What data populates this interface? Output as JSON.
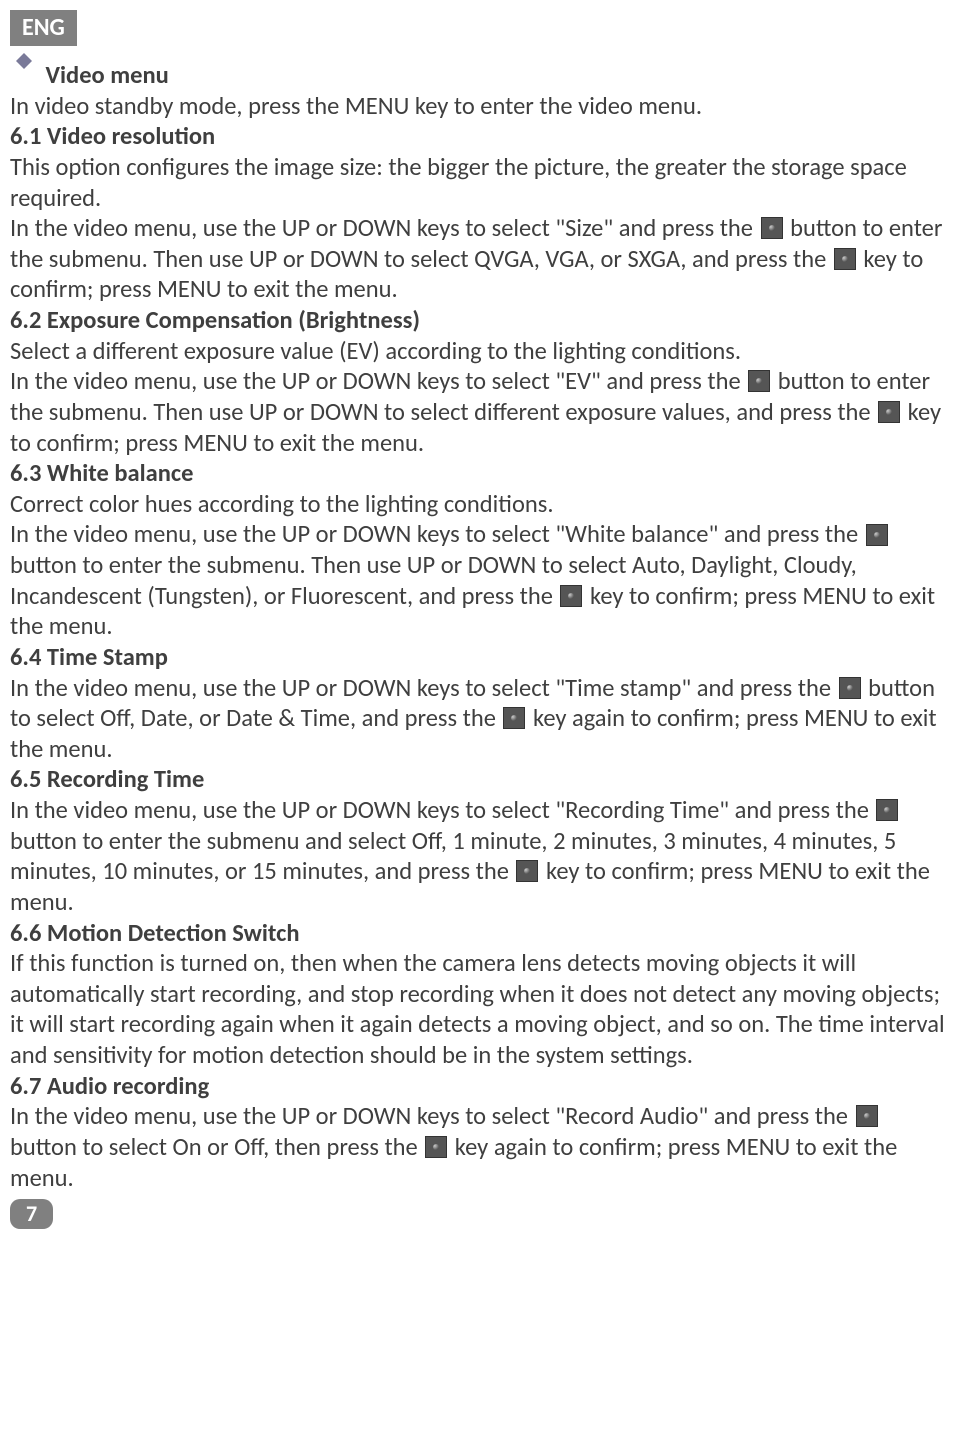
{
  "lang_tab": "ENG",
  "main_title": "Video menu",
  "intro": "In video standby mode, press the MENU key to enter the video menu.",
  "s61_title": "6.1 Video resolution",
  "s61_p1": "This option configures the image size: the bigger the picture, the greater the storage space required.",
  "s61_p2a": "In the video menu, use the UP or DOWN keys to select \"Size\" and press the ",
  "s61_p2b": " button to enter the submenu. Then use UP or DOWN to select QVGA, VGA, or SXGA, and press the ",
  "s61_p2c": " key to confirm; press MENU to exit the menu.",
  "s62_title": "6.2 Exposure Compensation (Brightness)",
  "s62_p1": "Select a different exposure value (EV) according to the lighting conditions.",
  "s62_p2a": "In the video menu, use the UP or DOWN keys to select \"EV\" and press the ",
  "s62_p2b": " button to enter the submenu. Then use UP or DOWN to select different exposure values, and press the ",
  "s62_p2c": " key to confirm; press MENU to exit the menu.",
  "s63_title": "6.3 White balance",
  "s63_p1": "Correct color hues according to the lighting conditions.",
  "s63_p2a": "In the video menu, use the UP or DOWN keys to select \"White balance\" and press the ",
  "s63_p2b": " button to enter the submenu. Then use UP or DOWN to select Auto, Daylight, Cloudy, Incandescent (Tungsten), or Fluorescent, and press the ",
  "s63_p2c": " key to confirm; press MENU to exit the menu.",
  "s64_title": "6.4 Time Stamp",
  "s64_p1a": "In the video menu, use the UP or DOWN keys to select \"Time stamp\" and press the ",
  "s64_p1b": " button to select Off, Date, or Date & Time, and press the ",
  "s64_p1c": " key again to confirm; press MENU to exit the menu.",
  "s65_title": "6.5 Recording Time",
  "s65_p1a": "In the video menu, use the UP or DOWN keys to select \"Recording Time\" and press the ",
  "s65_p1b": " button to enter the submenu and select Off, 1 minute, 2 minutes, 3 minutes, 4 minutes, 5 minutes, 10 minutes, or 15 minutes, and press the ",
  "s65_p1c": " key to confirm; press MENU to exit the menu.",
  "s66_title": "6.6 Motion Detection Switch",
  "s66_p1": "If this function is turned on, then when the camera lens detects moving objects it will automatically start recording, and stop recording when it does not detect any moving objects; it will start recording again when it again detects a moving object, and so on. The time interval and sensitivity for motion detection should be in the system settings.",
  "s67_title": "6.7 Audio recording",
  "s67_p1a": "In the video menu, use the UP or DOWN keys to select \"Record Audio\" and press the ",
  "s67_p1b": " button to select On or Off, then press the ",
  "s67_p1c": " key again to confirm; press MENU to exit the menu.",
  "page_number": "7"
}
